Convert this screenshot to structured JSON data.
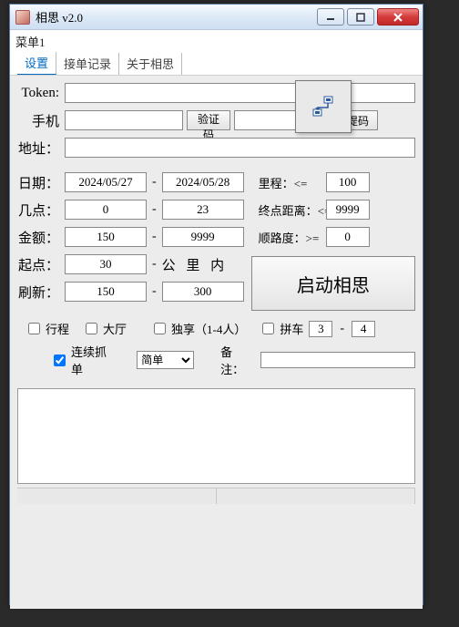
{
  "titlebar": {
    "title": "相思 v2.0"
  },
  "menu": {
    "top": "菜单1",
    "tabs": [
      "设置",
      "接单记录",
      "关于相思"
    ],
    "active": 0
  },
  "labels": {
    "token": "Token:",
    "phone": "手机",
    "address": "地址：",
    "date": "日期：",
    "hours": "几点：",
    "amount": "金额：",
    "start": "起点：",
    "refresh": "刷新：",
    "mileage": "里程：<=",
    "endDist": "终点距离：<=",
    "smooth": "顺路度：>=",
    "kmInside": "公 里 内",
    "verify": "验证码",
    "submit": "提码",
    "launch": "启动相思",
    "trip": "行程",
    "hall": "大厅",
    "solo": "独享（1-4人）",
    "carpool": "拼车",
    "continuous": "连续抓单",
    "mode": "简单",
    "remark": "备注："
  },
  "values": {
    "token": "",
    "phone": "",
    "captcha": "",
    "address": "",
    "dateFrom": "2024/05/27",
    "dateTo": "2024/05/28",
    "hourFrom": "0",
    "hourTo": "23",
    "amountFrom": "150",
    "amountTo": "9999",
    "startKm": "30",
    "refreshFrom": "150",
    "refreshTo": "300",
    "mileage": "100",
    "endDist": "9999",
    "smooth": "0",
    "carpoolFrom": "3",
    "carpoolTo": "4",
    "remark": "",
    "log": ""
  },
  "checks": {
    "trip": false,
    "hall": false,
    "solo": false,
    "carpool": false,
    "continuous": true
  }
}
